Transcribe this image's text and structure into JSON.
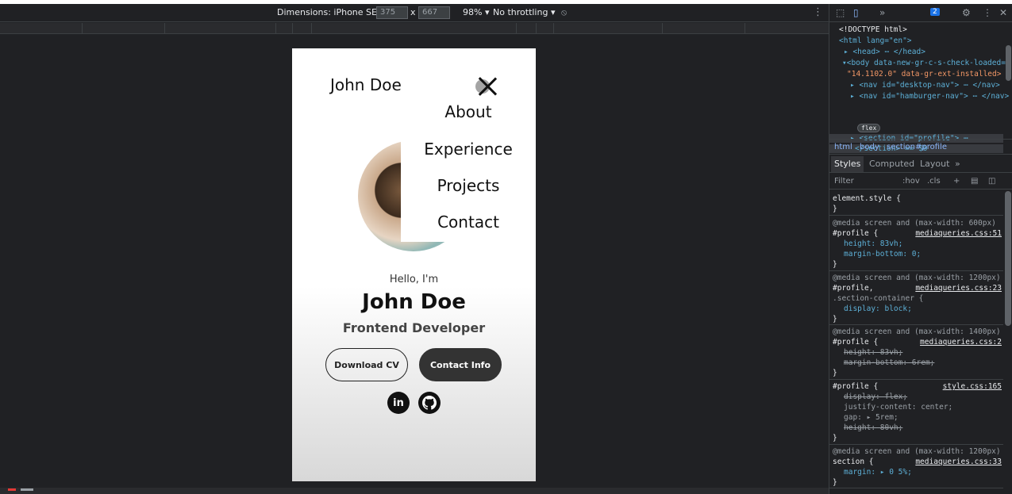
{
  "device_toolbar": {
    "dimensions_label": "Dimensions: iPhone SE",
    "width": "375",
    "height": "667",
    "times": "x",
    "zoom": "98%",
    "throttling": "No throttling"
  },
  "page": {
    "brand": "John Doe",
    "menu_links": [
      "About",
      "Experience",
      "Projects",
      "Contact"
    ],
    "hello": "Hello, I'm",
    "name": "John Doe",
    "role": "Frontend Developer",
    "download_cv": "Download CV",
    "contact_info": "Contact Info",
    "linkedin": "in",
    "github": "gh"
  },
  "devtools": {
    "badge_count": "2",
    "elements": [
      "<!DOCTYPE html>",
      "<html lang=\"en\">",
      "<head> ⋯ </head>",
      "<body data-new-gr-c-s-check-loaded=",
      "\"14.1102.0\" data-gr-ext-installed>",
      "<nav id=\"desktop-nav\"> ⋯ </nav>",
      "<nav id=\"hamburger-nav\"> ⋯ </nav>",
      "<section id=\"profile\"> ⋯",
      "</section> == $0"
    ],
    "flex_badge": "flex",
    "breadcrumbs": [
      "html",
      "body",
      "section#profile"
    ],
    "tabs": [
      "Styles",
      "Computed",
      "Layout"
    ],
    "filter_placeholder": "Filter",
    "filter_tools": [
      ":hov",
      ".cls",
      "+"
    ],
    "rules": {
      "element_style": "element.style {",
      "close": "}",
      "media_600": "@media screen and (max-width: 600px)",
      "profile_sel": "#profile {",
      "link_51": "mediaqueries.css:51",
      "height_83": "height: 83vh;",
      "margin_bottom_0": "margin-bottom: 0;",
      "media_1200": "@media screen and (max-width: 1200px)",
      "profile_comma": "#profile,",
      "link_23": "mediaqueries.css:23",
      "section_container": ".section-container {",
      "display_block": "display: block;",
      "media_1400": "@media screen and (max-width: 1400px)",
      "link_2": "mediaqueries.css:2",
      "margin_bottom_6": "margin-bottom: 6rem;",
      "link_165": "style.css:165",
      "display_flex": "display: flex;",
      "justify": "justify-content: center;",
      "gap": "gap: ▸ 5rem;",
      "height_80": "height: 80vh;",
      "section_sel": "section {",
      "link_33": "mediaqueries.css:33",
      "margin_5": "margin: ▸ 0 5%;"
    }
  }
}
